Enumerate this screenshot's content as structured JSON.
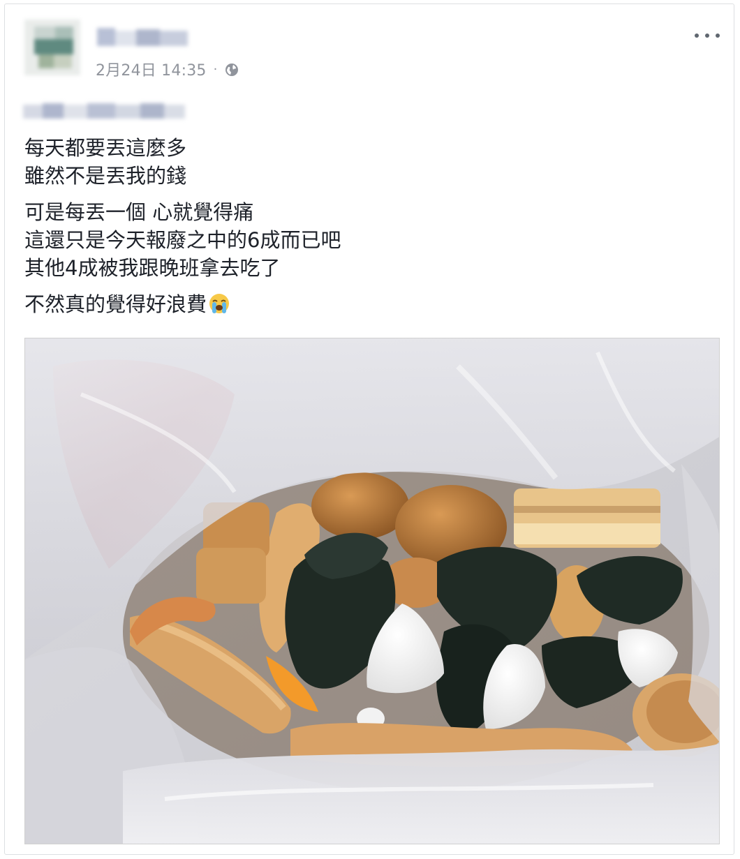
{
  "post": {
    "timestamp": "2月24日 14:35",
    "separator": "·",
    "privacy_icon": "globe-icon",
    "options_icon": "more-options-icon",
    "paragraphs": [
      [
        "每天都要丟這麼多",
        "雖然不是丟我的錢"
      ],
      [
        "可是每丟一個 心就覺得痛",
        "這還只是今天報廢之中的6成而已吧",
        "其他4成被我跟晚班拿去吃了"
      ],
      [
        "不然真的覺得好浪費"
      ]
    ],
    "trailing_emoji": "loudly-crying-face-emoji"
  },
  "photo": {
    "subject": "photo-of-discarded-food-in-plastic-bag"
  },
  "colors": {
    "text": "#1d2129",
    "meta": "#90949c",
    "border": "#dddfe2"
  }
}
